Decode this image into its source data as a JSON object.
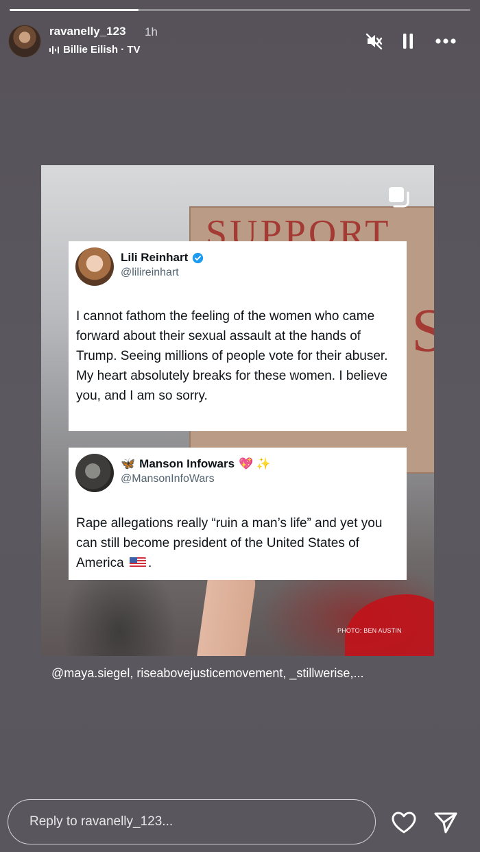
{
  "story": {
    "progress_fraction": 0.28,
    "username": "ravanelly_123",
    "time_ago": "1h",
    "music_label": "Billie Eilish · TV"
  },
  "post": {
    "sign_text": "SUPPORT",
    "sign_letter": "S",
    "photo_credit": "PHOTO: BEN AUSTIN",
    "tweets": [
      {
        "display_name": "Lili Reinhart",
        "handle": "@lilireinhart",
        "verified": true,
        "body_line1": "I cannot fathom the feeling of the women who came forward about their sexual assault at the hands of Trump. Seeing millions of people vote for their abuser.",
        "body_line2": "My heart absolutely breaks for these women. I believe you, and I am so sorry."
      },
      {
        "name_prefix_emoji": "🦋",
        "display_name": "Manson Infowars",
        "name_suffix_emoji": "💖 ✨",
        "handle": "@MansonInfoWars",
        "body": "Rape allegations really “ruin a man’s life” and yet you can still become president of the United States of America",
        "body_end": "."
      }
    ]
  },
  "caption": {
    "mentions": "@maya.siegel, riseabovejusticemovement, _stillwerise,..."
  },
  "reply": {
    "placeholder": "Reply to ravanelly_123..."
  },
  "icons": {
    "mute": "muted-speaker-icon",
    "pause": "pause-icon",
    "more": "more-options-icon",
    "like": "heart-icon",
    "share": "send-icon"
  },
  "colors": {
    "background": "#58545b",
    "verified_blue": "#1d9bf0",
    "sign_red": "#a43a34"
  }
}
